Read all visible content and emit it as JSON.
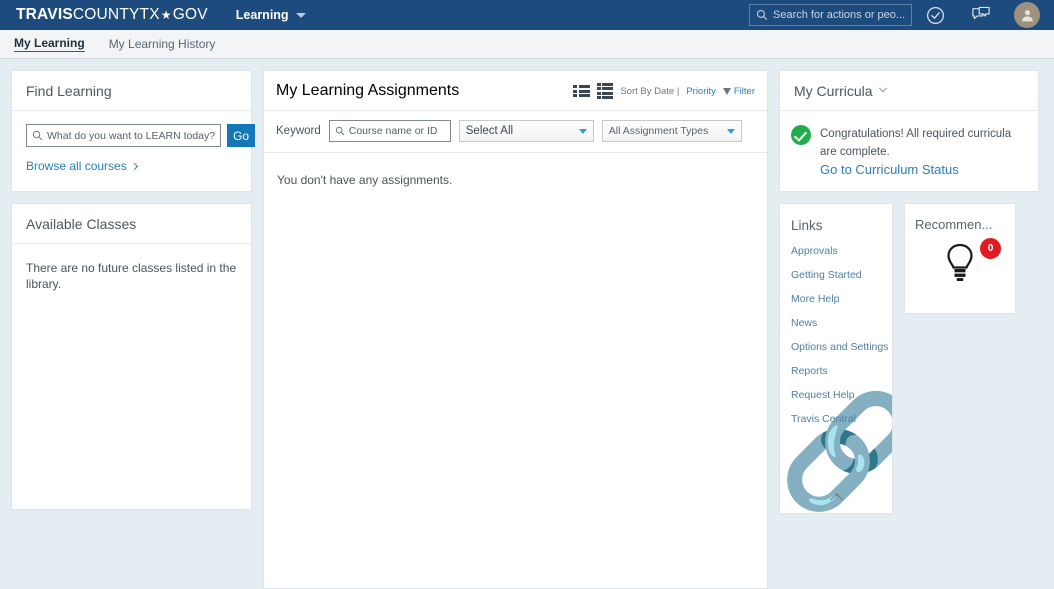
{
  "header": {
    "logo": {
      "bold": "TRAVIS",
      "light": "COUNTYTX",
      "star": "★",
      "tail": "GOV"
    },
    "nav_label": "Learning",
    "search_placeholder": "Search for actions or peo...",
    "icons": {
      "search": "search-icon",
      "approvals": "check-circle-icon",
      "notifications": "chat-notification-icon",
      "avatar": "user-avatar-icon"
    }
  },
  "subnav": {
    "tabs": [
      {
        "label": "My Learning",
        "active": true
      },
      {
        "label": "My Learning History",
        "active": false
      }
    ]
  },
  "find_learning": {
    "title": "Find Learning",
    "input_placeholder": "What do you want to LEARN today?",
    "go_label": "Go",
    "browse_label": "Browse all courses"
  },
  "available_classes": {
    "title": "Available Classes",
    "empty_text": "There are no future classes listed in the library."
  },
  "assignments": {
    "title": "My Learning Assignments",
    "sort_text": "Sort By Date |",
    "sort_priority": "Priority",
    "filter_label": "Filter",
    "keyword_label": "Keyword",
    "keyword_placeholder": "Course name or ID",
    "select_all": "Select All",
    "assignment_types": "All Assignment Types",
    "empty_text": "You don't have any assignments."
  },
  "curricula": {
    "title": "My Curricula",
    "message": "Congratulations! All required curricula are complete.",
    "link": "Go to Curriculum Status"
  },
  "links": {
    "title": "Links",
    "items": [
      {
        "label": "Approvals"
      },
      {
        "label": "Getting Started"
      },
      {
        "label": "More Help"
      },
      {
        "label": "News"
      },
      {
        "label": "Options and Settings"
      },
      {
        "label": "Reports"
      },
      {
        "label": "Request Help"
      },
      {
        "label": "Travis Central"
      }
    ]
  },
  "recommendations": {
    "title": "Recommen...",
    "count": "0"
  },
  "colors": {
    "header_blue": "#1e4b7d",
    "accent_blue": "#1477b8",
    "link_blue": "#2a7fb8",
    "success_green": "#22ac4e",
    "badge_red": "#e01b24",
    "page_bg": "#e3edf2"
  }
}
